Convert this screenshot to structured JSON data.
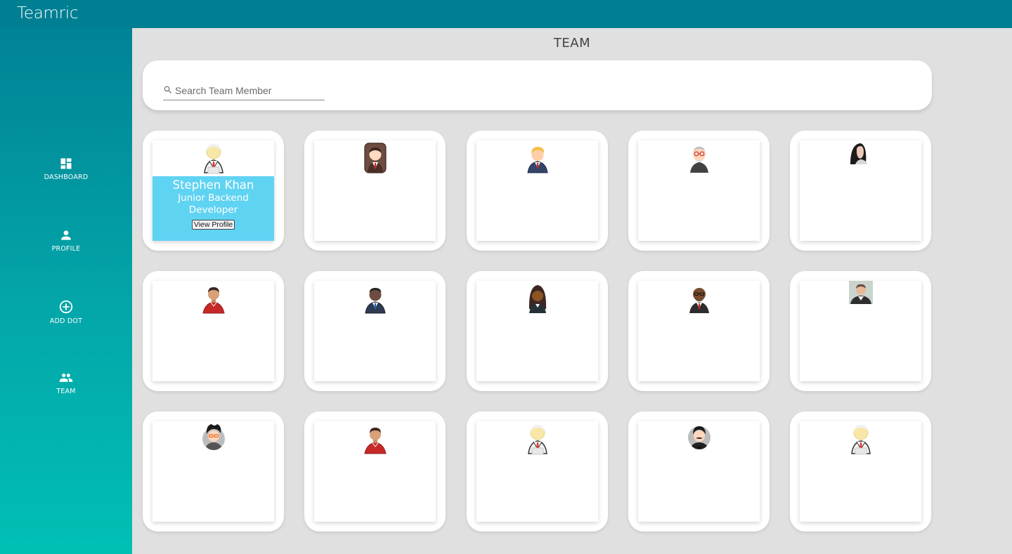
{
  "app": {
    "brand": "Teamric"
  },
  "sidebar": {
    "items": [
      {
        "label": "DASHBOARD",
        "icon": "dashboard-icon"
      },
      {
        "label": "PROFILE",
        "icon": "person-icon"
      },
      {
        "label": "ADD DOT",
        "icon": "add-circle-icon"
      },
      {
        "label": "TEAM",
        "icon": "group-icon"
      }
    ]
  },
  "page": {
    "title": "TEAM"
  },
  "search": {
    "placeholder": "Search Team Member",
    "value": ""
  },
  "colors": {
    "topbar": "#007f93",
    "sidebar_top": "#007f93",
    "sidebar_bottom": "#00c0b4",
    "background": "#e0e0e0",
    "hover_panel": "#5fd3f2"
  },
  "members": [
    {
      "avatar": "businessman-avatar",
      "name": "Stephen Khan",
      "role": "Junior Backend Developer",
      "action": "View Profile"
    },
    {
      "avatar": "man-on-chair-avatar"
    },
    {
      "avatar": "blonde-man-suit-avatar"
    },
    {
      "avatar": "old-man-glasses-avatar"
    },
    {
      "avatar": "woman-photo-avatar"
    },
    {
      "avatar": "man-red-shirt-avatar"
    },
    {
      "avatar": "man-dark-suit-avatar"
    },
    {
      "avatar": "woman-dark-hair-avatar"
    },
    {
      "avatar": "bald-man-glasses-avatar"
    },
    {
      "avatar": "man-photo-avatar"
    },
    {
      "avatar": "man-glasses-hair-avatar"
    },
    {
      "avatar": "man-red-shirt-avatar"
    },
    {
      "avatar": "businessman-avatar"
    },
    {
      "avatar": "man-mustache-avatar"
    },
    {
      "avatar": "businessman-avatar"
    }
  ]
}
